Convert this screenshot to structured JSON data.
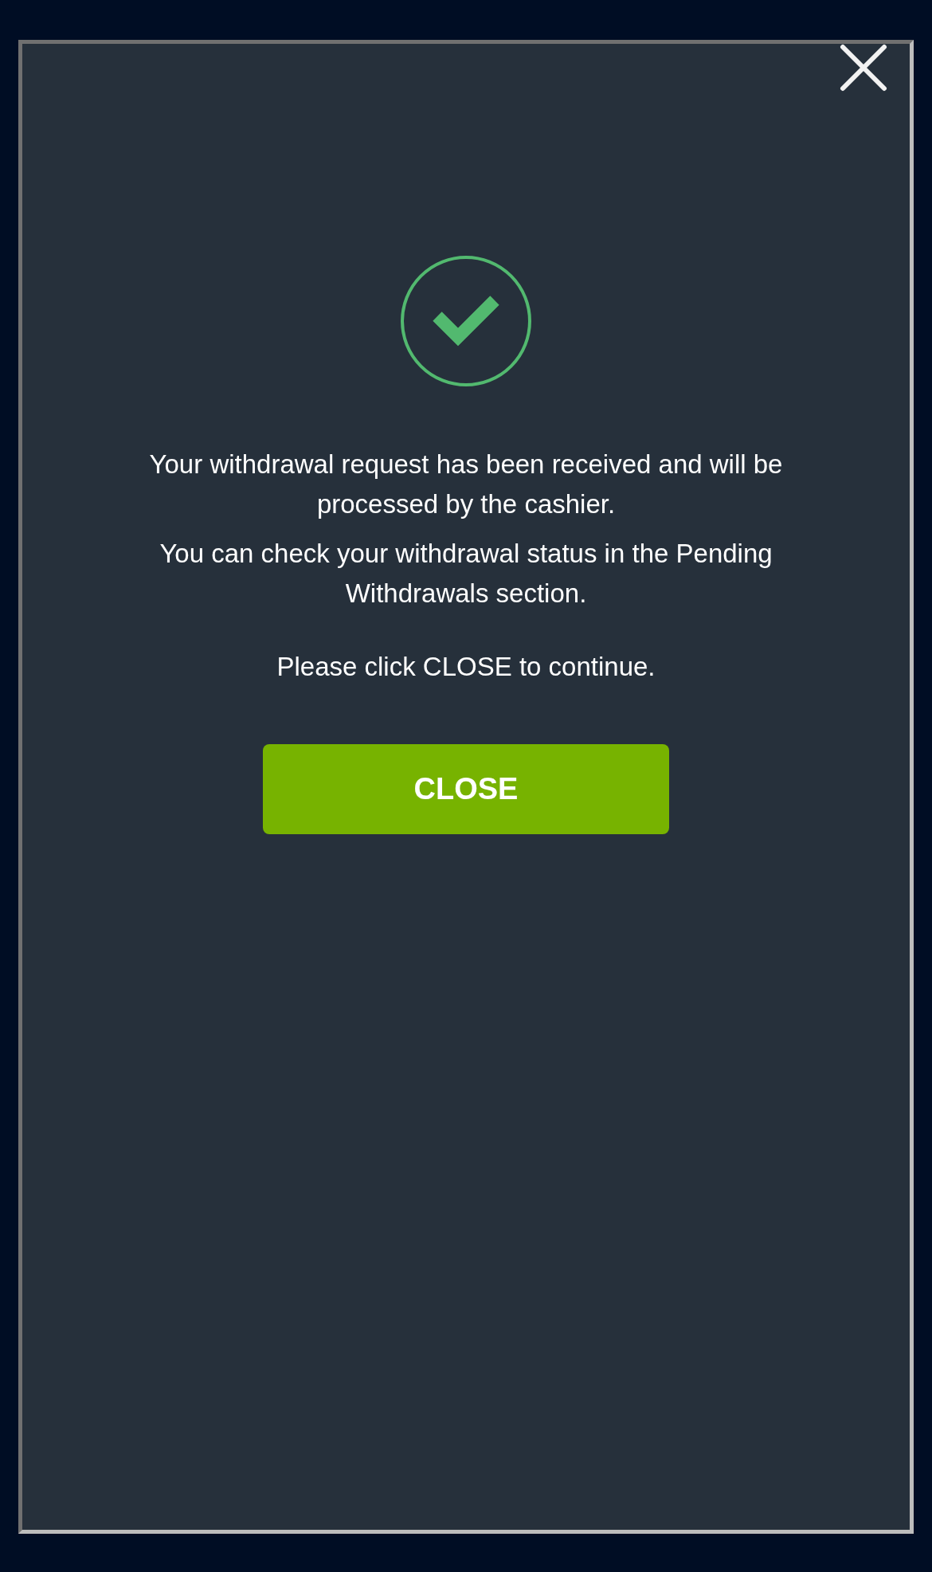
{
  "dialog": {
    "messages": [
      "Your withdrawal request has been received and will be processed by the cashier.",
      "You can check your withdrawal status in the Pending Withdrawals section.",
      "Please click CLOSE to continue."
    ],
    "button": "CLOSE"
  }
}
